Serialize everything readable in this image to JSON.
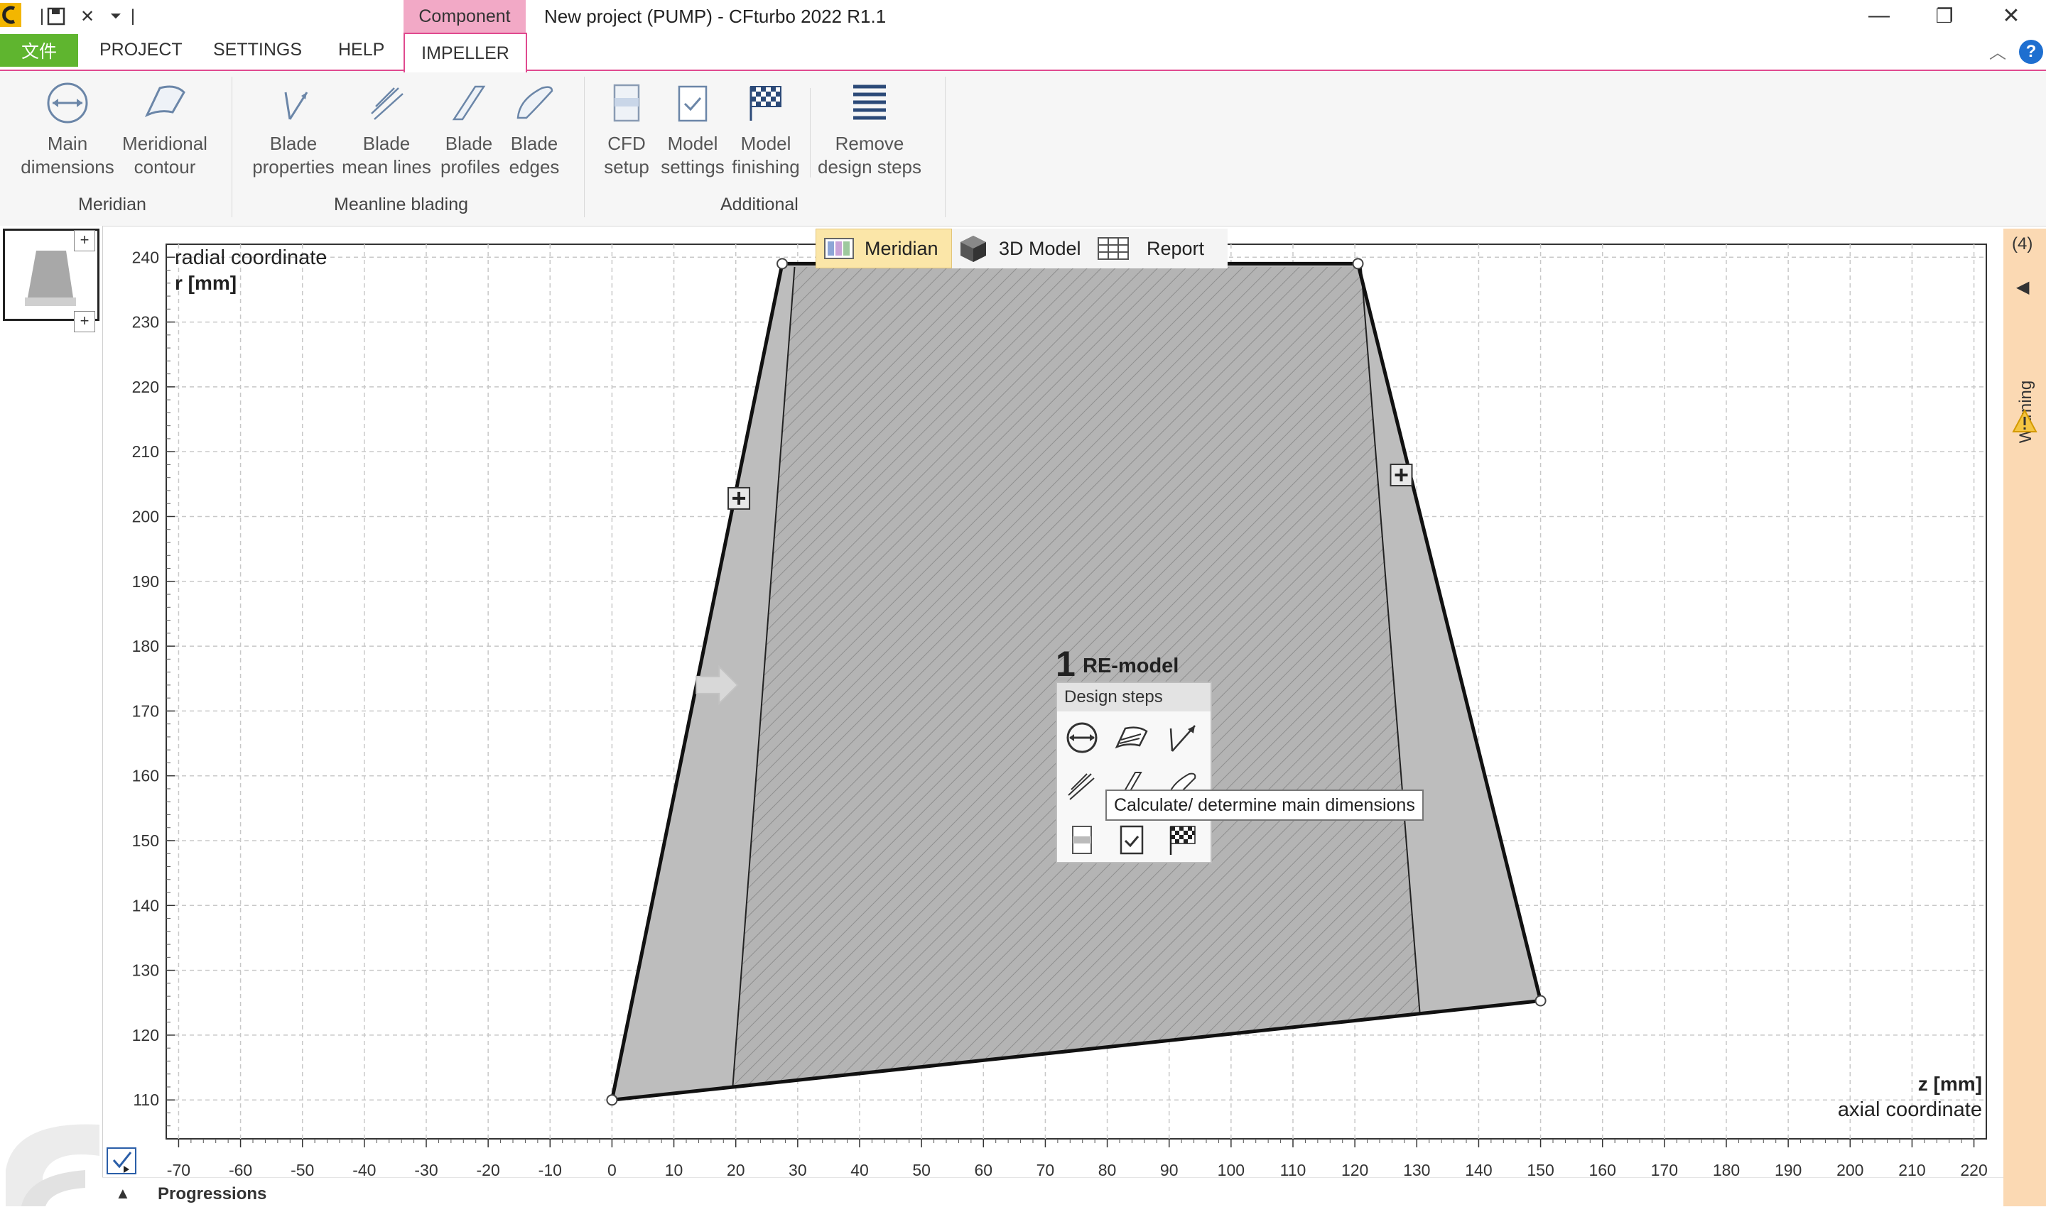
{
  "titlebar": {
    "context_tab": "Component",
    "title": "New project (PUMP) - CFturbo 2022 R1.1",
    "icons": [
      "app-logo-icon",
      "save-icon",
      "close-doc-icon",
      "dropdown-icon"
    ],
    "window_buttons": [
      "minimize-icon",
      "restore-icon",
      "close-icon"
    ]
  },
  "menu": {
    "file": "文件",
    "items": [
      "PROJECT",
      "SETTINGS",
      "HELP",
      "IMPELLER"
    ],
    "help_glyph": "?"
  },
  "ribbon": {
    "buttons": [
      {
        "line1": "Main",
        "line2": "dimensions",
        "icon": "main-dimensions-icon"
      },
      {
        "line1": "Meridional",
        "line2": "contour",
        "icon": "meridional-contour-icon"
      },
      {
        "line1": "Blade",
        "line2": "properties",
        "icon": "blade-properties-icon"
      },
      {
        "line1": "Blade",
        "line2": "mean lines",
        "icon": "blade-mean-lines-icon"
      },
      {
        "line1": "Blade",
        "line2": "profiles",
        "icon": "blade-profiles-icon"
      },
      {
        "line1": "Blade",
        "line2": "edges",
        "icon": "blade-edges-icon"
      },
      {
        "line1": "CFD",
        "line2": "setup",
        "icon": "cfd-setup-icon"
      },
      {
        "line1": "Model",
        "line2": "settings",
        "icon": "model-settings-icon"
      },
      {
        "line1": "Model",
        "line2": "finishing",
        "icon": "model-finishing-icon"
      },
      {
        "line1": "Remove",
        "line2": "design steps",
        "icon": "remove-design-steps-icon"
      }
    ],
    "groups": [
      "Meridian",
      "Meanline blading",
      "Additional"
    ]
  },
  "views": {
    "meridian": "Meridian",
    "model3d": "3D Model",
    "report": "Report",
    "active": "Meridian"
  },
  "chart_data": {
    "type": "line",
    "ylabel_title": "radial coordinate",
    "ylabel_unit": "r [mm]",
    "xlabel_unit": "z [mm]",
    "xlabel_title": "axial coordinate",
    "xlim": [
      -72,
      222
    ],
    "ylim": [
      104,
      242
    ],
    "xticks": [
      -70,
      -60,
      -50,
      -40,
      -30,
      -20,
      -10,
      0,
      10,
      20,
      30,
      40,
      50,
      60,
      70,
      80,
      90,
      100,
      110,
      120,
      130,
      140,
      150,
      160,
      170,
      180,
      190,
      200,
      210,
      220
    ],
    "yticks": [
      110,
      120,
      130,
      140,
      150,
      160,
      170,
      180,
      190,
      200,
      210,
      220,
      230,
      240
    ],
    "grid": true,
    "series": [
      {
        "kind": "hub-contour",
        "x": [
          0,
          150
        ],
        "y": [
          110,
          125.3
        ]
      },
      {
        "kind": "shroud-contour",
        "x": [
          27.5,
          120.5
        ],
        "y": [
          239,
          239
        ]
      },
      {
        "kind": "leading-edge-outline",
        "x": [
          0,
          27.5
        ],
        "y": [
          110,
          239
        ]
      },
      {
        "kind": "trailing-edge-outline",
        "x": [
          120.5,
          150
        ],
        "y": [
          239,
          125.3
        ]
      },
      {
        "kind": "blade-leading-edge",
        "x": [
          19.5,
          29.5
        ],
        "y": [
          112,
          238.5
        ]
      },
      {
        "kind": "blade-trailing-edge",
        "x": [
          130.5,
          121
        ],
        "y": [
          124,
          238.5
        ]
      }
    ],
    "control_points": [
      {
        "x": 0,
        "y": 110
      },
      {
        "x": 27.5,
        "y": 239
      },
      {
        "x": 120.5,
        "y": 239
      },
      {
        "x": 150,
        "y": 125.3
      }
    ],
    "edit_markers": [
      {
        "x": 20.5,
        "y": 202.8
      },
      {
        "x": 127.5,
        "y": 206.4
      }
    ],
    "arrow_marker": {
      "x": 18,
      "y": 174
    }
  },
  "design_steps": {
    "number": "1",
    "model_name": "RE-model",
    "header": "Design steps",
    "icons": [
      "main-dimensions-icon",
      "meridional-contour-icon",
      "blade-properties-icon",
      "blade-mean-lines-icon",
      "blade-profiles-icon",
      "blade-edges-icon",
      "cfd-setup-icon",
      "model-settings-icon",
      "model-finishing-icon"
    ],
    "tooltip": "Calculate/ determine main dimensions"
  },
  "warning_panel": {
    "count": "(4)",
    "label": "Warning"
  },
  "bottom": {
    "progressions": "Progressions"
  },
  "colors": {
    "accent_pink": "#e04a8f",
    "file_green": "#5fb52f",
    "meridian_fill": "#b9b9b9",
    "warning_bg": "#fbd9b3"
  }
}
